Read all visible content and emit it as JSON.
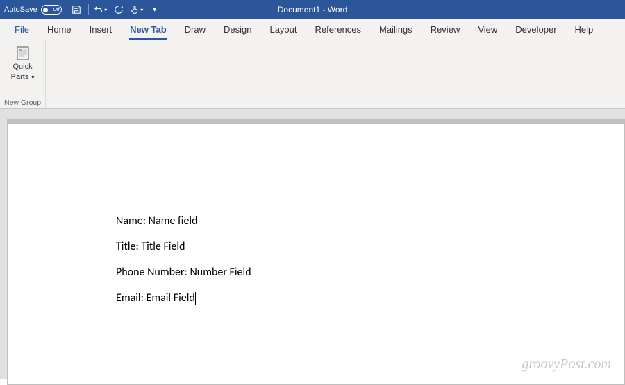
{
  "titlebar": {
    "autosave_label": "AutoSave",
    "autosave_state": "Off",
    "doc_title": "Document1  -  Word"
  },
  "menubar": {
    "items": [
      {
        "label": "File"
      },
      {
        "label": "Home"
      },
      {
        "label": "Insert"
      },
      {
        "label": "New Tab"
      },
      {
        "label": "Draw"
      },
      {
        "label": "Design"
      },
      {
        "label": "Layout"
      },
      {
        "label": "References"
      },
      {
        "label": "Mailings"
      },
      {
        "label": "Review"
      },
      {
        "label": "View"
      },
      {
        "label": "Developer"
      },
      {
        "label": "Help"
      }
    ],
    "active_index": 3
  },
  "ribbon": {
    "quick_parts": {
      "label_line1": "Quick",
      "label_line2": "Parts"
    },
    "group_label": "New Group"
  },
  "document": {
    "lines": [
      "Name: Name field",
      "Title: Title Field",
      "Phone Number: Number Field",
      "Email: Email Field"
    ]
  },
  "watermark": "groovyPost.com"
}
